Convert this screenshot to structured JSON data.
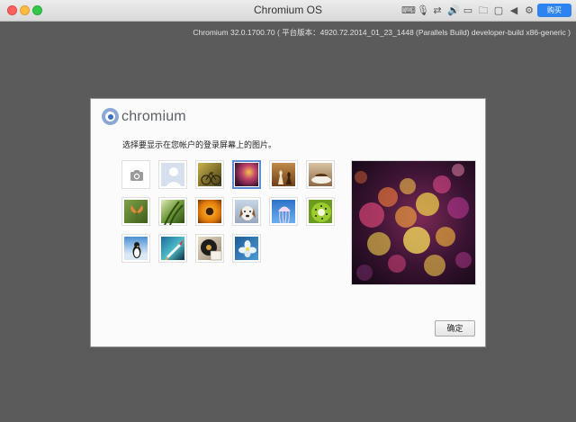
{
  "window": {
    "title": "Chromium OS",
    "toolbar_icons": [
      "keyboard-icon",
      "mic-icon",
      "network-icon",
      "volume-icon",
      "display-icon",
      "folder-icon",
      "window-icon",
      "back-icon",
      "gear-icon"
    ],
    "button_label": "购买"
  },
  "version_text": "Chromium 32.0.1700.70 ( 平台版本：4920.72.2014_01_23_1448 (Parallels Build) developer-build x86-generic )",
  "dialog": {
    "logo_text": "chromium",
    "prompt": "选择要显示在您帐户的登录屏幕上的图片。",
    "images": [
      {
        "name": "camera",
        "selected": false
      },
      {
        "name": "default-avatar",
        "selected": false
      },
      {
        "name": "bicycle",
        "selected": false
      },
      {
        "name": "bokeh",
        "selected": true
      },
      {
        "name": "chess",
        "selected": false
      },
      {
        "name": "coffee",
        "selected": false
      },
      {
        "name": "butterfly-flower",
        "selected": false
      },
      {
        "name": "grass",
        "selected": false
      },
      {
        "name": "sunflower",
        "selected": false
      },
      {
        "name": "dog",
        "selected": false
      },
      {
        "name": "jellyfish",
        "selected": false
      },
      {
        "name": "kiwi",
        "selected": false
      },
      {
        "name": "penguin",
        "selected": false
      },
      {
        "name": "rocket",
        "selected": false
      },
      {
        "name": "vinyl",
        "selected": false
      },
      {
        "name": "flower-blue",
        "selected": false
      }
    ],
    "ok_label": "确定"
  }
}
